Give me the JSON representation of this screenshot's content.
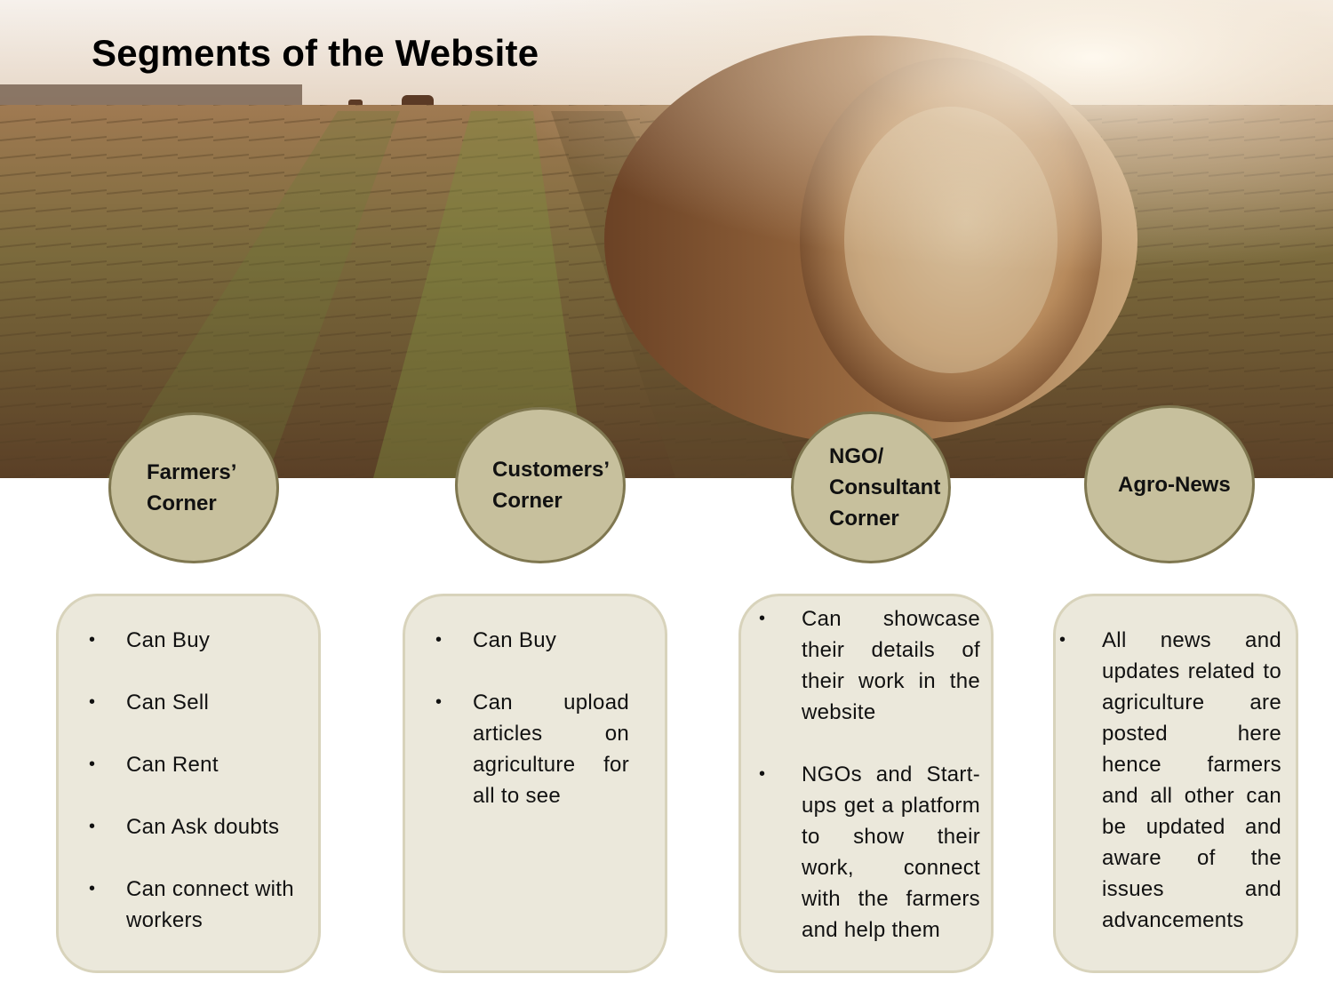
{
  "title": "Segments of the Website",
  "colors": {
    "circle_fill": "#c7c09d",
    "circle_border": "#7f7750",
    "card_fill": "#ebe8db",
    "card_border": "#d8d3bb"
  },
  "segments": [
    {
      "label": "Farmers’\nCorner",
      "items": [
        "Can Buy",
        "Can Sell",
        "Can Rent",
        "Can Ask doubts",
        "Can connect with workers"
      ]
    },
    {
      "label": "Customers’\nCorner",
      "items": [
        "Can Buy",
        "Can upload articles on agriculture for all to see"
      ]
    },
    {
      "label": "NGO/\nConsultant\nCorner",
      "items": [
        "Can showcase their details of their work in the website",
        "NGOs and Start-ups get a platform to show their work, connect with the farmers and help them"
      ]
    },
    {
      "label": "Agro-News",
      "items": [
        "All news and updates related to agriculture are posted here hence farmers and all other can be updated and aware of the issues and advancements"
      ]
    }
  ]
}
